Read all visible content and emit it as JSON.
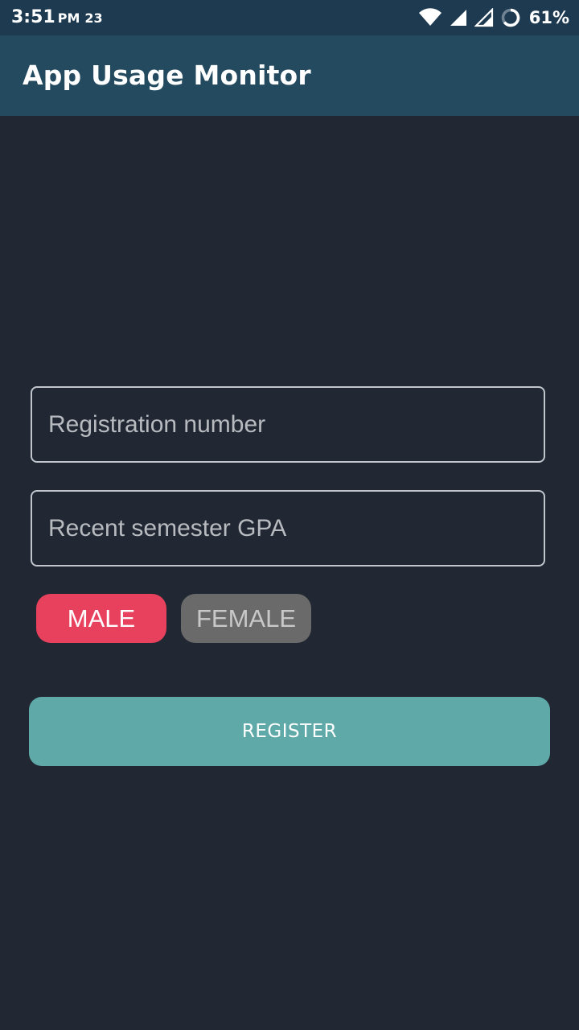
{
  "status_bar": {
    "time": "3:51",
    "ampm": "PM",
    "extra": "23",
    "battery_percent": "61%",
    "icons": [
      "wifi-icon",
      "signal-icon",
      "signal-icon-2",
      "battery-ring-icon"
    ]
  },
  "app_bar": {
    "title": "App Usage Monitor"
  },
  "form": {
    "registration_placeholder": "Registration number",
    "registration_value": "",
    "gpa_placeholder": "Recent semester GPA",
    "gpa_value": "",
    "gender": {
      "options": [
        "MALE",
        "FEMALE"
      ],
      "selected": "MALE",
      "male_label": "MALE",
      "female_label": "FEMALE"
    },
    "register_label": "REGISTER"
  },
  "colors": {
    "status_bar": "#1d3a50",
    "app_bar": "#244a60",
    "background": "#222833",
    "male_selected": "#e8415e",
    "female_unselected": "#6a6a6a",
    "register_button": "#5fa9a8"
  }
}
